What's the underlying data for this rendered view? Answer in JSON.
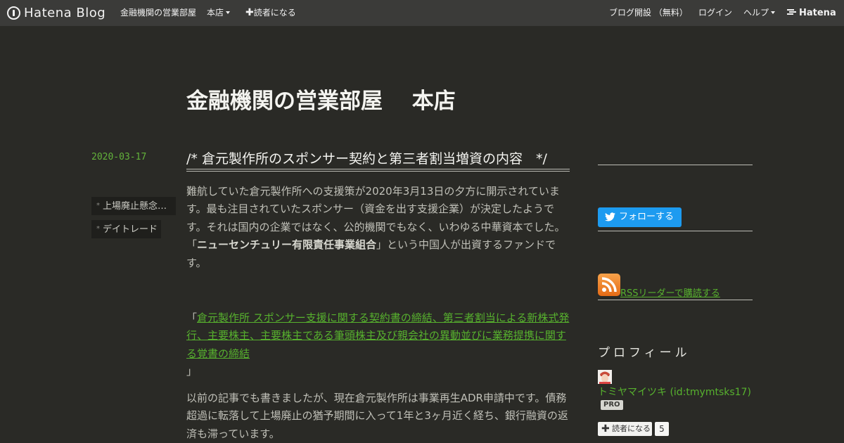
{
  "topbar": {
    "logo_text": "Hatena Blog",
    "blog_name": "金融機関の営業部屋",
    "honten": "本店",
    "subscribe": "読者になる",
    "open_blog": "ブログ開設 （無料）",
    "login": "ログイン",
    "help": "ヘルプ",
    "hatena": "Hatena"
  },
  "blog": {
    "title": "金融機関の営業部屋　 本店"
  },
  "entry": {
    "date": "2020-03-17",
    "title": "/*  倉元製作所のスポンサー契約と第三者割当増資の内容　*/",
    "categories": [
      "上場廃止懸念…",
      "デイトレード"
    ],
    "p1_a": "難航していた倉元製作所への支援策が2020年3月13日の夕方に開示されています。最も注目されていたスポンサー（資金を出す支援企業）が決定したようです。それは国内の企業ではなく、公的機関でもなく、いわゆる中華資本でした。「",
    "p1_bold": "ニューセンチュリー有限責任事業組合",
    "p1_b": "」という中国人が出資するファンドです。",
    "link_open": "「",
    "link_text": "倉元製作所 スポンサー支援に関する契約書の締結、第三者割当による新株式発行、主要株主、主要株主である筆頭株主及び親会社の異動並びに業務提携に関する覚書の締結",
    "link_close": "」",
    "p2": "以前の記事でも書きましたが、現在倉元製作所は事業再生ADR申請中です。債務超過に転落して上場廃止の猶予期間に入って1年と3ヶ月近く経ち、銀行融資の返済も滞っています。"
  },
  "sidebar": {
    "follow_label": "フォローする",
    "rss_label": "RSSリーダーで購読する",
    "profile_heading": "プロフィール",
    "profile_name": "トミヤマイツキ (id:tmymtsks17)",
    "pro_badge": "PRO",
    "subscribe_label": "読者になる",
    "subscriber_count": "5"
  },
  "colors": {
    "background": "#2a2a26",
    "topbar": "#3b3b39",
    "link_green": "#57b12e",
    "twitter_blue": "#1d9bf0",
    "rss_orange": "#f29130"
  },
  "icons": [
    "hatena-blog-logo-icon",
    "caret-down-icon",
    "plus-icon",
    "twitter-bird-icon",
    "rss-icon",
    "hatena-logo-icon"
  ]
}
